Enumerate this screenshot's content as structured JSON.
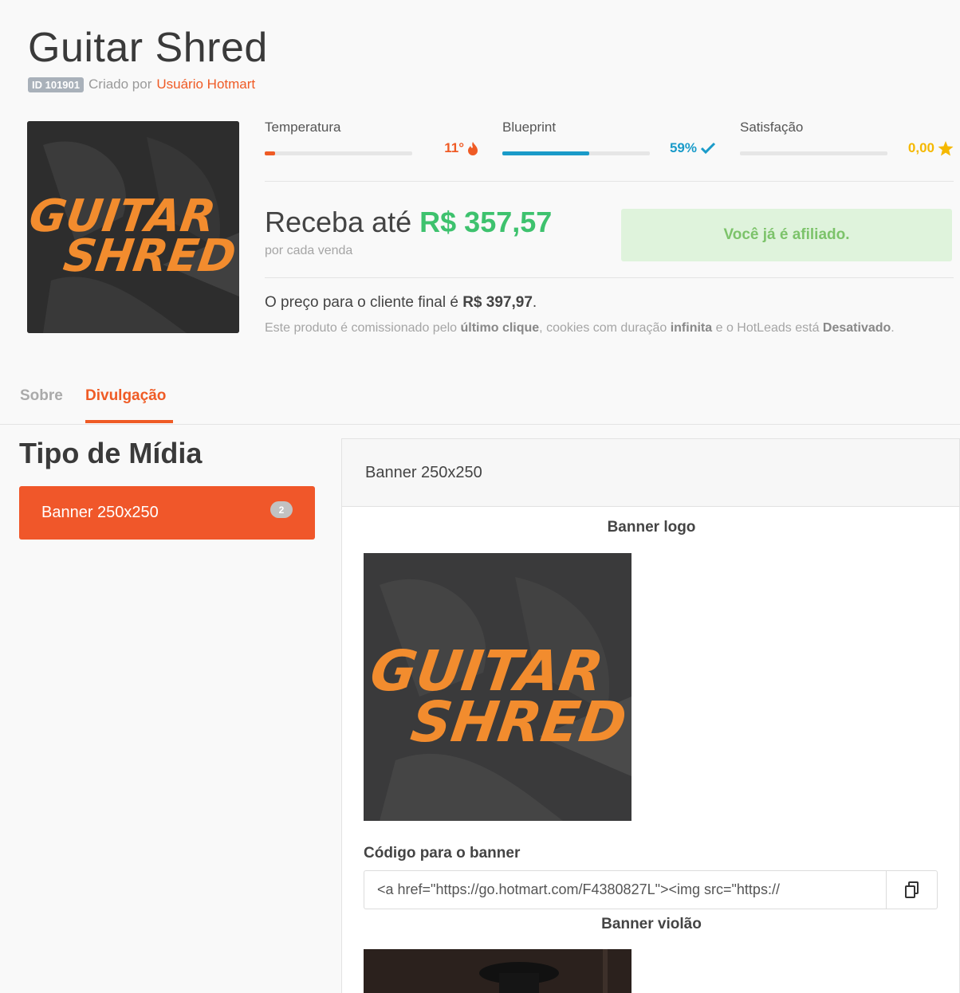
{
  "product": {
    "title": "Guitar Shred",
    "id_badge": "ID 101901",
    "created_by_label": "Criado por",
    "creator_name": "Usuário Hotmart",
    "cover_text_line1": "GUITAR",
    "cover_text_line2": "SHRED"
  },
  "metrics": [
    {
      "label": "Temperatura",
      "value": "11°",
      "icon": "flame-icon",
      "fill": 0.07,
      "color": "#ef5b25"
    },
    {
      "label": "Blueprint",
      "value": "59%",
      "icon": "check-icon",
      "fill": 0.59,
      "color": "#1a9bc9"
    },
    {
      "label": "Satisfação",
      "value": "0,00",
      "icon": "star-icon",
      "fill": 0.0,
      "color": "#f5b800"
    }
  ],
  "earnings": {
    "prefix": "Receba até",
    "amount": "R$ 357,57",
    "sub": "por cada venda"
  },
  "affiliate_status": "Você já é afiliado.",
  "pricing": {
    "final_price_text": "O preço para o cliente final é",
    "final_price_value": "R$ 397,97",
    "final_price_suffix": ".",
    "note_1": "Este produto é comissionado pelo",
    "note_last_click": "último clique",
    "note_2": ", cookies com duração",
    "note_infinite": "infinita",
    "note_3": "e o HotLeads está",
    "note_disabled": "Desativado",
    "note_4": "."
  },
  "tabs": [
    {
      "label": "Sobre",
      "active": false
    },
    {
      "label": "Divulgação",
      "active": true
    }
  ],
  "media": {
    "title": "Tipo de Mídia",
    "items": [
      {
        "label": "Banner 250x250",
        "count": "2"
      }
    ]
  },
  "panel": {
    "header": "Banner 250x250",
    "banners": [
      {
        "caption": "Banner logo"
      },
      {
        "caption": "Banner violão"
      }
    ],
    "code_label": "Código para o banner",
    "code_value": "<a href=\"https://go.hotmart.com/F4380827L\"><img src=\"https://"
  },
  "colors": {
    "accent": "#ef5b25",
    "green": "#3ec26e",
    "blueprint": "#1a9bc9",
    "star": "#f5b800"
  }
}
